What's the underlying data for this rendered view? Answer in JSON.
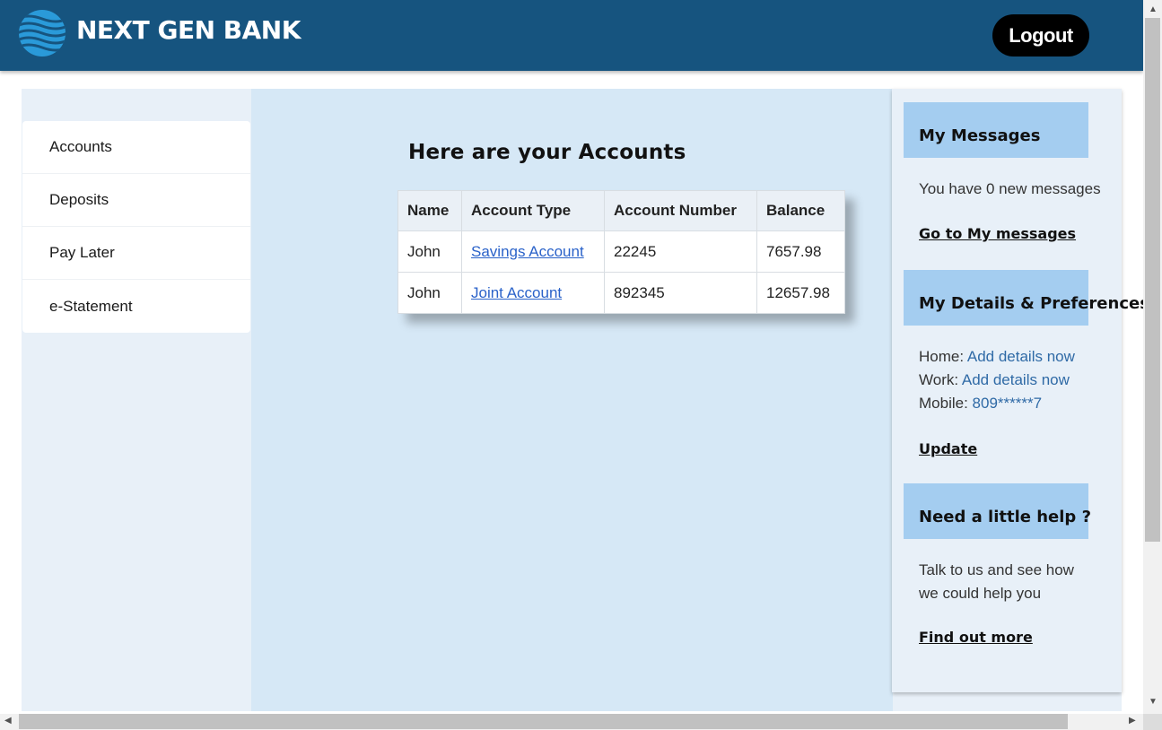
{
  "header": {
    "brand": "NEXT GEN BANK",
    "logout_label": "Logout",
    "logo_icon": "globe-wave-icon"
  },
  "sidebar": {
    "items": [
      {
        "label": "Accounts"
      },
      {
        "label": "Deposits"
      },
      {
        "label": "Pay Later"
      },
      {
        "label": "e-Statement"
      }
    ]
  },
  "main": {
    "title": "Here are your Accounts",
    "columns": [
      "Name",
      "Account Type",
      "Account Number",
      "Balance"
    ],
    "rows": [
      {
        "name": "John",
        "type": "Savings Account",
        "number": "22245",
        "balance": "7657.98"
      },
      {
        "name": "John",
        "type": "Joint Account",
        "number": "892345",
        "balance": "12657.98"
      }
    ]
  },
  "messages": {
    "title": "My Messages",
    "text": "You have 0 new messages",
    "link": "Go to My messages"
  },
  "details": {
    "title": "My Details & Preferences",
    "home_label": "Home:",
    "home_value": "Add details now",
    "work_label": "Work:",
    "work_value": "Add details now",
    "mobile_label": "Mobile:",
    "mobile_value": "809******7",
    "update": "Update"
  },
  "help": {
    "title": "Need a little help ?",
    "line1": "Talk to us and see how",
    "line2": "we could help you",
    "link": "Find out more"
  },
  "colors": {
    "header_bg": "#16547f",
    "box_head": "#a4cdf0",
    "main_bg": "#d6e8f6",
    "link": "#2a62c9"
  }
}
